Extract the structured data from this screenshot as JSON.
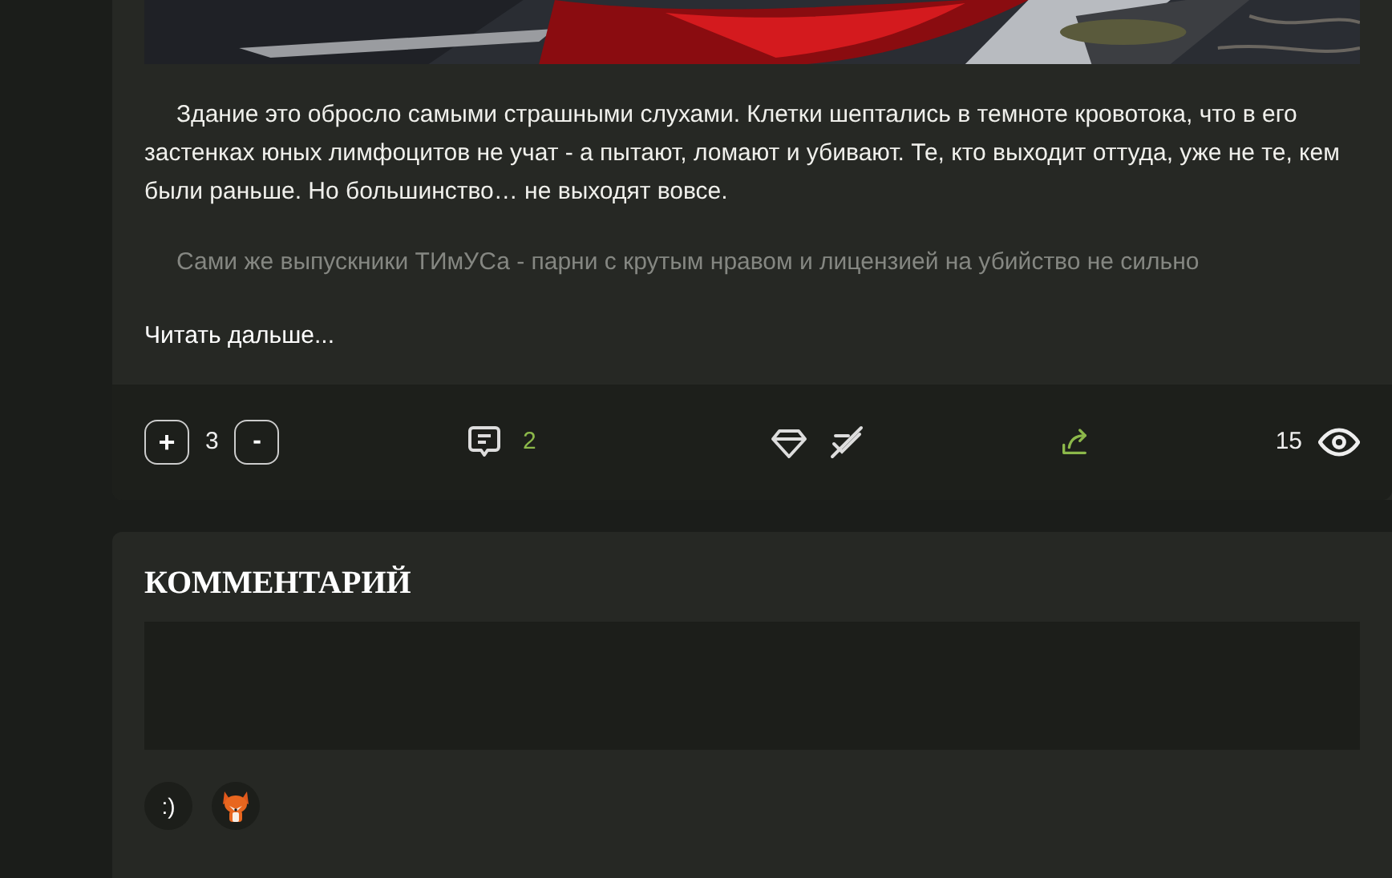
{
  "post": {
    "paragraphs": [
      {
        "text": "Здание это обросло самыми страшными слухами. Клетки шептались в темноте кровотока, что в его застенках юных лимфоцитов не учат - а пытают, ломают и убивают. Те, кто выходит оттуда, уже не те, кем были раньше. Но большинство… не выходят вовсе.",
        "faded": false
      },
      {
        "text": "Сами же выпускники ТИмУСа - парни с крутым нравом и лицензией на убийство не сильно",
        "faded": true
      }
    ],
    "read_more": "Читать дальше...",
    "footer": {
      "plus": "+",
      "rating": "3",
      "minus": "-",
      "comments": "2",
      "views": "15"
    }
  },
  "comment": {
    "title": "КОММЕНТАРИЙ",
    "emoji_button": ":)"
  }
}
